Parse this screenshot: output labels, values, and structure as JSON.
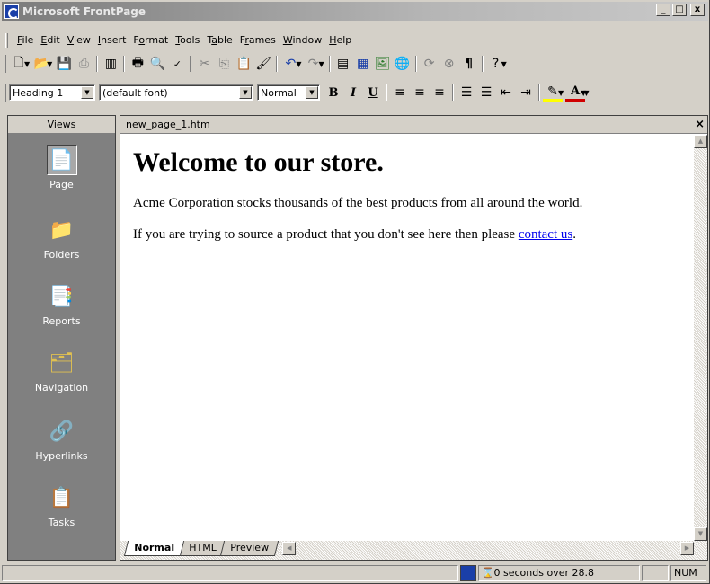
{
  "window": {
    "title": "Microsoft FrontPage",
    "btn_min": "_",
    "btn_max": "□",
    "btn_close": "x"
  },
  "menu": [
    {
      "label": "File",
      "key": "F"
    },
    {
      "label": "Edit",
      "key": "E"
    },
    {
      "label": "View",
      "key": "V"
    },
    {
      "label": "Insert",
      "key": "I"
    },
    {
      "label": "Format",
      "key": "o"
    },
    {
      "label": "Tools",
      "key": "T"
    },
    {
      "label": "Table",
      "key": "a"
    },
    {
      "label": "Frames",
      "key": "r"
    },
    {
      "label": "Window",
      "key": "W"
    },
    {
      "label": "Help",
      "key": "H"
    }
  ],
  "format_bar": {
    "style": "Heading 1",
    "font": "(default font)",
    "size": "Normal",
    "bold": "B",
    "italic": "I",
    "underline": "U"
  },
  "views": {
    "header": "Views",
    "items": [
      {
        "label": "Page"
      },
      {
        "label": "Folders"
      },
      {
        "label": "Reports"
      },
      {
        "label": "Navigation"
      },
      {
        "label": "Hyperlinks"
      },
      {
        "label": "Tasks"
      }
    ]
  },
  "document": {
    "filename": "new_page_1.htm",
    "close": "×",
    "heading": "Welcome to our store.",
    "paragraph1": "Acme Corporation stocks thousands of the best products from all around the world.",
    "paragraph2_before": "If you are trying to source a product that you don't see here then please ",
    "paragraph2_link": "contact us",
    "paragraph2_after": "."
  },
  "view_tabs": {
    "normal": "Normal",
    "html": "HTML",
    "preview": "Preview"
  },
  "status": {
    "download_time": "0 seconds over 28.8",
    "num": "NUM"
  }
}
